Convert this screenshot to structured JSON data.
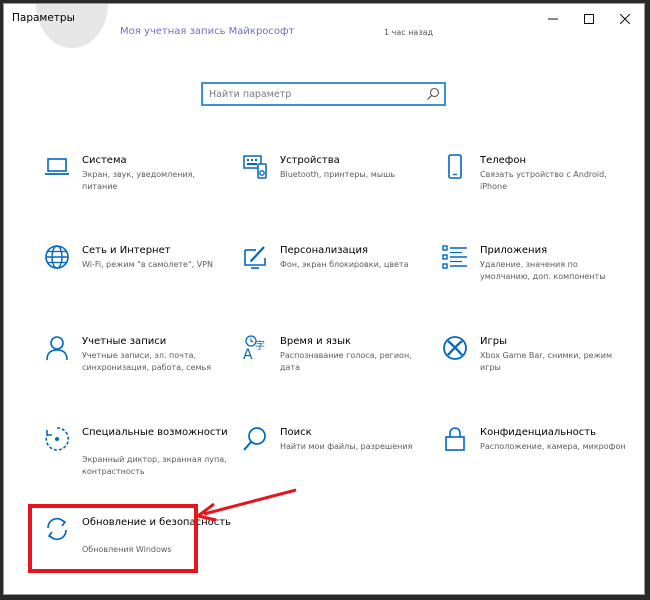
{
  "window": {
    "title": "Параметры",
    "account_link": "Моя учетная запись Майкрософт",
    "account_time": "1 час назад",
    "controls": {
      "minimize": "—",
      "maximize": "□",
      "close": "✕"
    }
  },
  "search": {
    "placeholder": "Найти параметр",
    "value": ""
  },
  "tiles": [
    {
      "name": "Система",
      "desc": "Экран, звук, уведомления, питание",
      "icon": "laptop-icon"
    },
    {
      "name": "Устройства",
      "desc": "Bluetooth, принтеры, мышь",
      "icon": "devices-icon"
    },
    {
      "name": "Телефон",
      "desc": "Связать устройство с Android, iPhone",
      "icon": "phone-icon"
    },
    {
      "name": "Сеть и Интернет",
      "desc": "Wi-Fi, режим \"в самолете\", VPN",
      "icon": "globe-icon"
    },
    {
      "name": "Персонализация",
      "desc": "Фон, экран блокировки, цвета",
      "icon": "personalization-icon"
    },
    {
      "name": "Приложения",
      "desc": "Удаление, значения по умолчанию, доп. компоненты",
      "icon": "apps-list-icon"
    },
    {
      "name": "Учетные записи",
      "desc": "Учетные записи, эл. почта, синхронизация, работа, семья",
      "icon": "person-icon"
    },
    {
      "name": "Время и язык",
      "desc": "Распознавание голоса, регион, дата",
      "icon": "time-language-icon"
    },
    {
      "name": "Игры",
      "desc": "Xbox Game Bar, снимки, режим игры",
      "icon": "xbox-icon"
    },
    {
      "name": "Специальные возможности",
      "desc": "Экранный диктор, экранная лупа, контрастность",
      "icon": "accessibility-icon"
    },
    {
      "name": "Поиск",
      "desc": "Найти мои файлы, разрешения",
      "icon": "search-magnifier-icon"
    },
    {
      "name": "Конфиденциальность",
      "desc": "Расположение, камера, микрофон",
      "icon": "lock-icon"
    },
    {
      "name": "Обновление и безопасность",
      "desc": "Обновления Windows",
      "icon": "update-sync-icon"
    }
  ],
  "colors": {
    "accent": "#0067c0",
    "focus_border": "#3c92d6",
    "annotation_red": "#e8141b"
  }
}
